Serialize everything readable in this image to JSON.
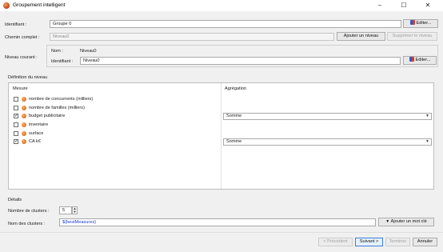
{
  "window": {
    "title": "Groupement intelligent",
    "controls": [
      "–",
      "☐",
      "✕"
    ]
  },
  "identifiant": {
    "label": "Identifiant :",
    "value": "Groupe 0",
    "button": "Editer..."
  },
  "chemin": {
    "label": "Chemin complet :",
    "placeholder": "Niveau0",
    "add_button": "Ajouter un niveau",
    "remove_button": "Supprimer le niveau"
  },
  "niveau": {
    "label": "Niveau courant :",
    "nom_label": "Nom :",
    "nom_value": "Niveau0",
    "id_label": "Identifiant :",
    "id_value": "Niveau0",
    "button": "Editer..."
  },
  "definition": {
    "title": "Définition du niveau",
    "col_mesure": "Mesure",
    "col_agregation": "Agrégation",
    "rows": [
      {
        "label": "nombre de concurrents (milliers)",
        "checked": false,
        "aggregation": ""
      },
      {
        "label": "nombre de familles (milliers)",
        "checked": false,
        "aggregation": ""
      },
      {
        "label": "budget publicitaire",
        "checked": true,
        "aggregation": "Somme"
      },
      {
        "label": "inventaire",
        "checked": false,
        "aggregation": ""
      },
      {
        "label": "surface",
        "checked": false,
        "aggregation": ""
      },
      {
        "label": "CA k€",
        "checked": true,
        "aggregation": "Somme"
      }
    ]
  },
  "details": {
    "title": "Détails",
    "clusters_label": "Nombre de clusters :",
    "clusters_value": "5",
    "names_label": "Nom des clusters :",
    "names_value": "${bestMeasures}",
    "keyword_button": "Ajouter un mot clé"
  },
  "footer": {
    "prev": "< Précédent",
    "next": "Suivant >",
    "finish": "Terminer",
    "cancel": "Annuler"
  }
}
